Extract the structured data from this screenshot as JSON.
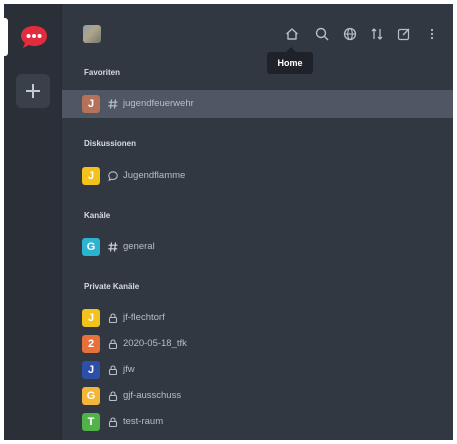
{
  "header": {
    "tooltip": "Home",
    "icons": [
      "home-icon",
      "search-icon",
      "globe-icon",
      "sort-icon",
      "pencil-icon",
      "kebab-icon"
    ]
  },
  "sections": {
    "favorites": "Favoriten",
    "discussions": "Diskussionen",
    "channels": "Kanäle",
    "private": "Private Kanäle"
  },
  "rooms": [
    {
      "letter": "J",
      "name": "jugendfeuerwehr",
      "type": "hash",
      "color": "#b5715a"
    },
    {
      "letter": "J",
      "name": "Jugendflamme",
      "type": "discussion",
      "color": "#f3c21c"
    },
    {
      "letter": "G",
      "name": "general",
      "type": "hash",
      "color": "#2ab4cf"
    },
    {
      "letter": "J",
      "name": "jf-flechtorf",
      "type": "lock",
      "color": "#f3c21c"
    },
    {
      "letter": "2",
      "name": "2020-05-18_tfk",
      "type": "lock",
      "color": "#e8703a"
    },
    {
      "letter": "J",
      "name": "jfw",
      "type": "lock",
      "color": "#2e4fa8"
    },
    {
      "letter": "G",
      "name": "gjf-ausschuss",
      "type": "lock",
      "color": "#f3b53a"
    },
    {
      "letter": "T",
      "name": "test-raum",
      "type": "lock",
      "color": "#52b24a"
    }
  ],
  "colors": {
    "accent": "#e32b3b",
    "sidebar": "#2f343d",
    "active_row": "#505764"
  }
}
